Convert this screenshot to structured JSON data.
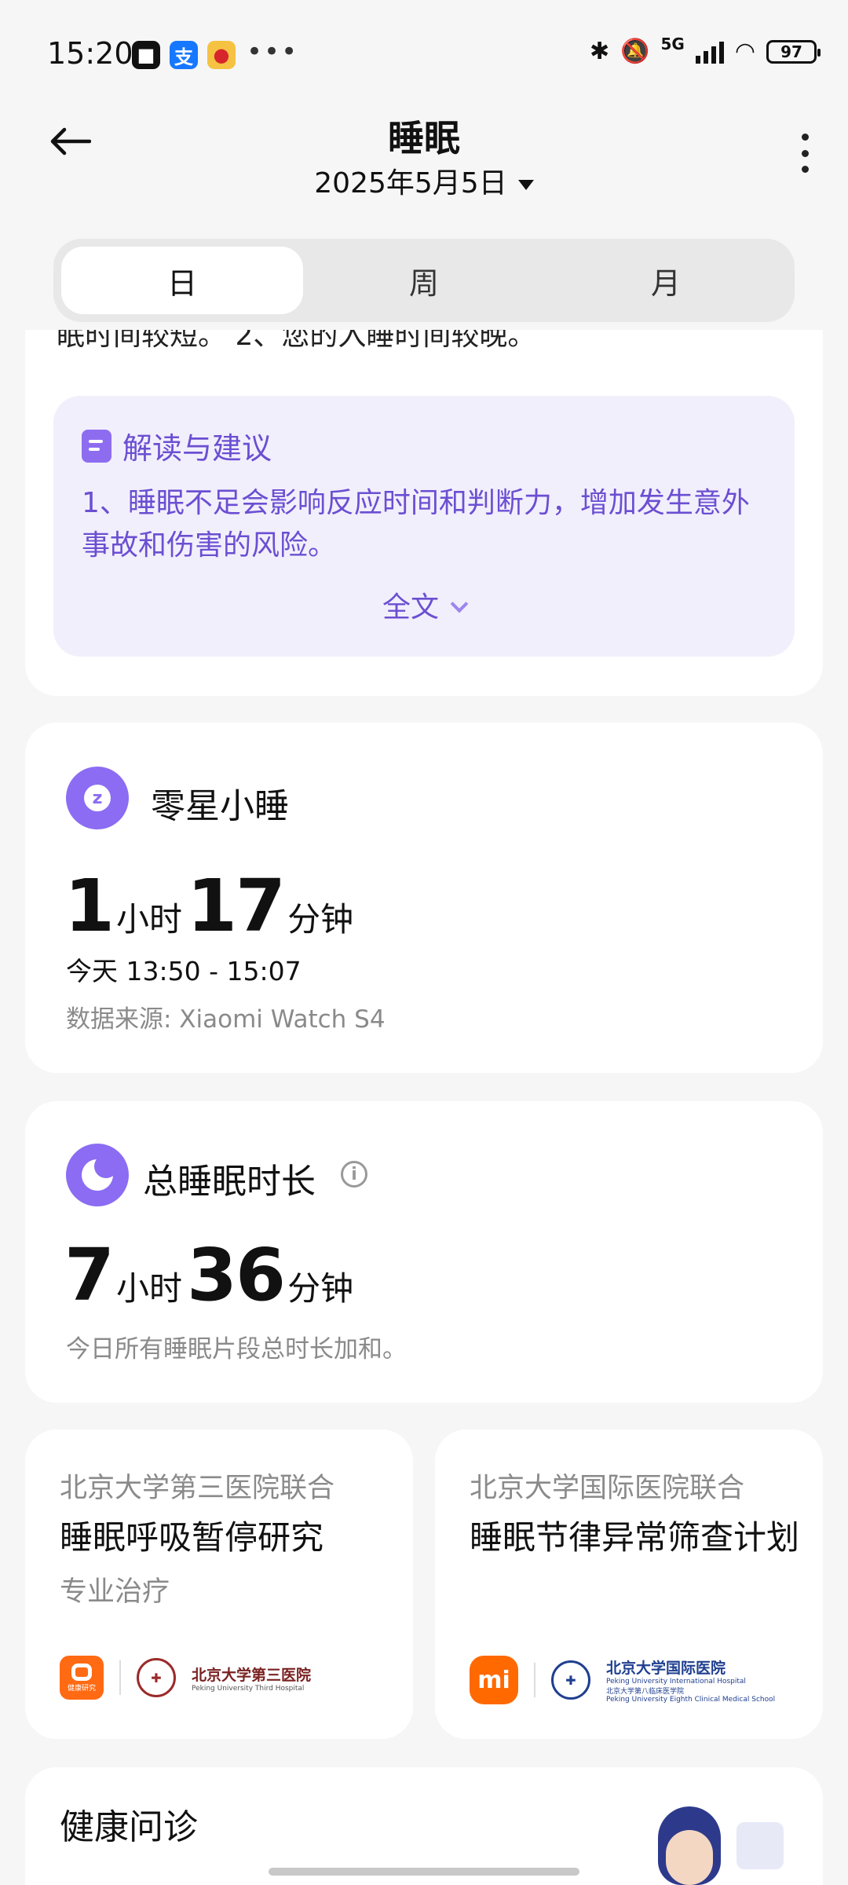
{
  "status_bar": {
    "time": "15:20",
    "apps": [
      "■",
      "支",
      "●"
    ],
    "more": "•••",
    "network": "5G",
    "battery": "97"
  },
  "header": {
    "title": "睡眠",
    "date": "2025年5月5日"
  },
  "tabs": [
    {
      "label": "日",
      "active": true
    },
    {
      "label": "周",
      "active": false
    },
    {
      "label": "月",
      "active": false
    }
  ],
  "summary_card": {
    "cut_text": "眠时间较短。 2、您的入睡时间较晚。",
    "advice": {
      "title": "解读与建议",
      "body": "1、睡眠不足会影响反应时间和判断力，增加发生意外事故和伤害的风险。",
      "full_text_label": "全文"
    }
  },
  "nap_card": {
    "title": "零星小睡",
    "hours": "1",
    "hours_unit": "小时",
    "minutes": "17",
    "minutes_unit": "分钟",
    "time_range": "今天 13:50 - 15:07",
    "source": "数据来源: Xiaomi Watch S4"
  },
  "total_card": {
    "title": "总睡眠时长",
    "hours": "7",
    "hours_unit": "小时",
    "minutes": "36",
    "minutes_unit": "分钟",
    "note": "今日所有睡眠片段总时长加和。"
  },
  "research": [
    {
      "org": "北京大学第三医院联合",
      "title": "睡眠呼吸暂停研究",
      "subtitle": "专业治疗",
      "logo_small": "健康研究",
      "hospital_cn": "北京大学第三医院",
      "hospital_en": "Peking University Third Hospital"
    },
    {
      "org": "北京大学国际医院联合",
      "title": "睡眠节律异常筛查计划",
      "logo_small": "mi",
      "hospital_cn": "北京大学国际医院",
      "hospital_en": "Peking University International Hospital",
      "hospital_cn2": "北京大学第八临床医学院",
      "hospital_en2": "Peking University Eighth Clinical Medical School"
    }
  ],
  "consult_card": {
    "title": "健康问诊"
  },
  "colors": {
    "accent": "#8b6cf3",
    "advice_text": "#6b4fd2",
    "advice_bg": "#f2effc",
    "xiaomi_orange": "#ff6900"
  }
}
